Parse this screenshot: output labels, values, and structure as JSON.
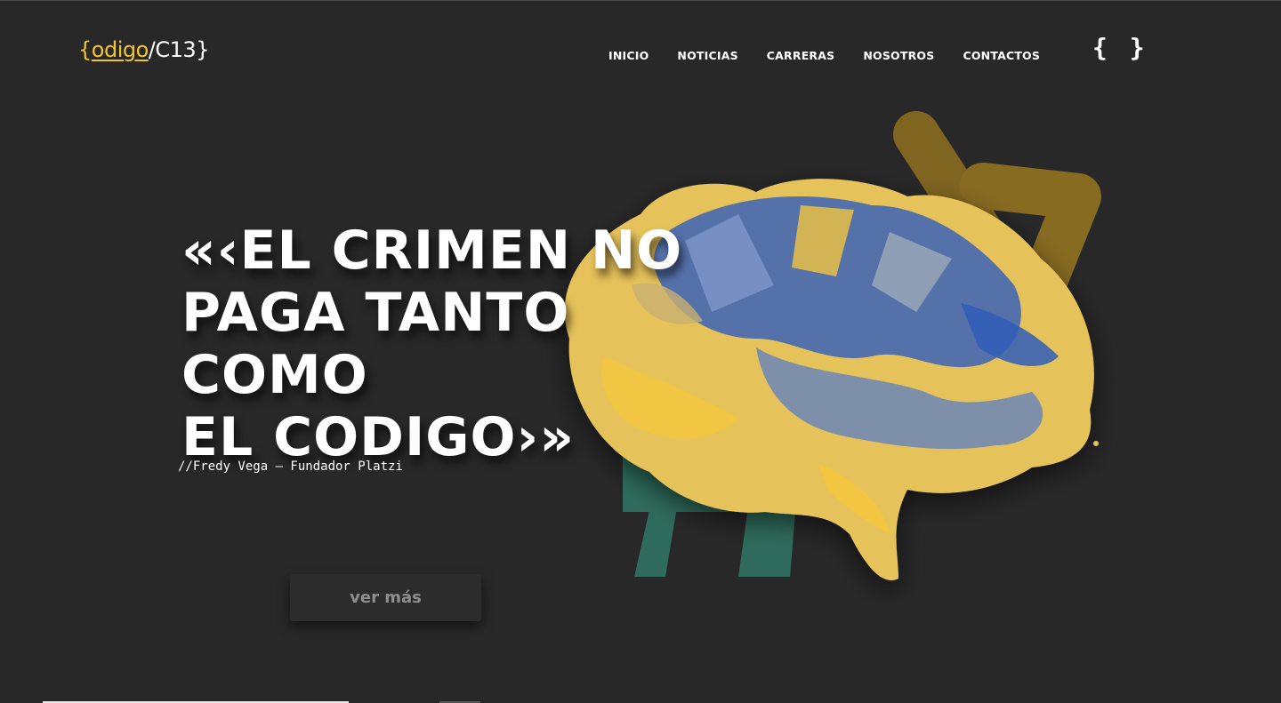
{
  "header": {
    "logo": {
      "open_brace": "{",
      "word": "odigo",
      "slash_part": "/C13",
      "close_brace": "}"
    },
    "nav": [
      "INICIO",
      "NOTICIAS",
      "CARRERAS",
      "NOSOTROS",
      "CONTACTOS"
    ],
    "icon": "{ }"
  },
  "hero": {
    "headline": "«‹EL CRIMEN NO\nPAGA TANTO COMO\nEL CODIGO›»",
    "author": "//Fredy Vega — Fundador Platzi",
    "cta_label": "ver más"
  },
  "colors": {
    "background": "#282828",
    "brand_yellow": "#f4c430",
    "brain_blue": "#3a63b8",
    "hash_green": "#2f6b5c",
    "chevron_gold": "#8a6e22"
  },
  "icons": [
    "curly-braces-icon",
    "brain-illustration",
    "hash-symbol",
    "chevron-symbol"
  ]
}
